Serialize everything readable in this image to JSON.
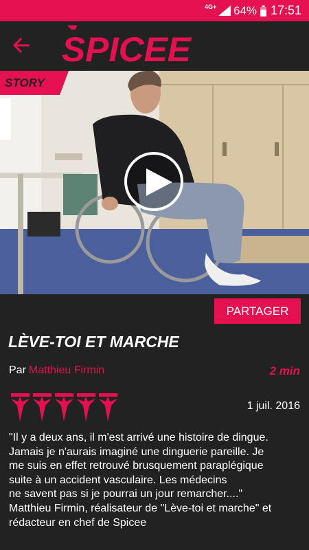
{
  "status_bar": {
    "network": "4G+",
    "signal_icon": "signal-icon",
    "battery_percent": "64%",
    "battery_icon": "battery-icon",
    "time": "17:51"
  },
  "colors": {
    "accent": "#e5104f",
    "background": "#222222",
    "text": "#ffffff"
  },
  "app_bar": {
    "back_icon": "arrow-left-icon",
    "logo_text": "SPICEE"
  },
  "video": {
    "badge": "STORY",
    "play_icon": "play-icon"
  },
  "actions": {
    "share_label": "PARTAGER"
  },
  "article": {
    "title": "LÈVE-TOI ET MARCHE",
    "by_label": "Par",
    "author": "Matthieu Firmin",
    "duration": "2 min",
    "rating": {
      "icon": "spicee-star-icon",
      "count": 5
    },
    "date": "1 juil. 2016",
    "description": "\"Il y a deux ans, il m'est arrivé une histoire de dingue.\nJamais je n'aurais imaginé une dinguerie pareille. Je\nme suis en effet retrouvé brusquement paraplégique\nsuite à un accident vasculaire. Les médecins\nne savent pas si je pourrai un jour remarcher....\"\nMatthieu Firmin, réalisateur de \"Lève-toi et marche\" et\nrédacteur en chef de Spicee"
  }
}
